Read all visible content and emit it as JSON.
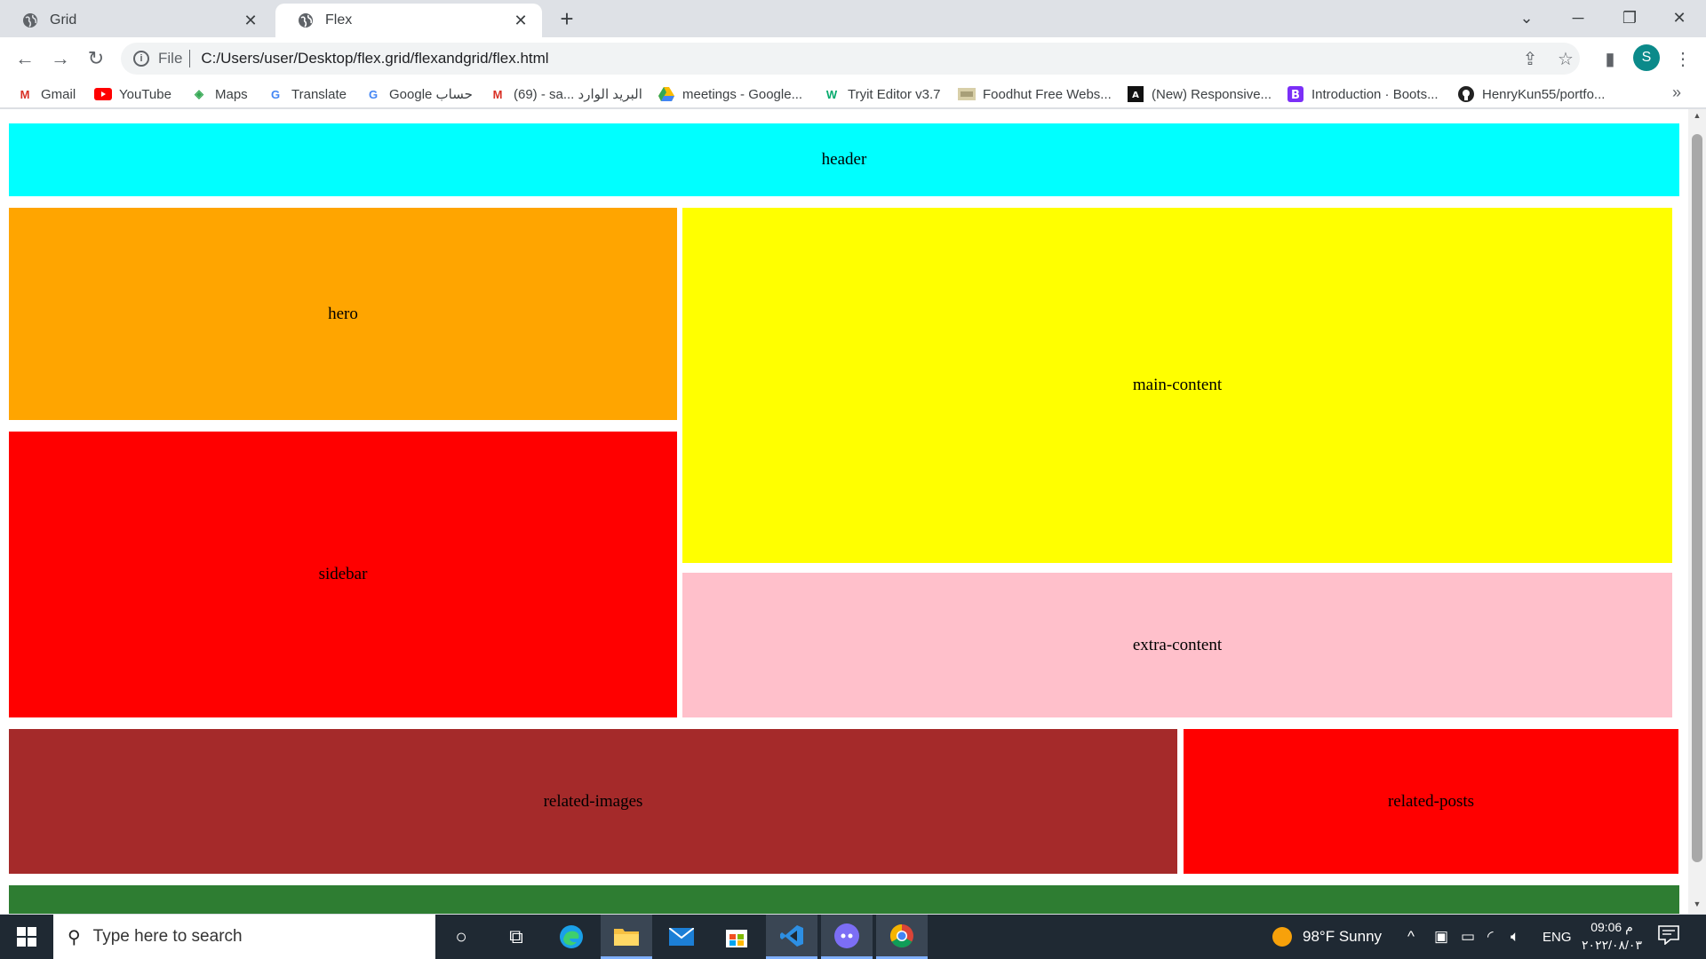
{
  "tabs": [
    {
      "title": "Grid",
      "active": false
    },
    {
      "title": "Flex",
      "active": true
    }
  ],
  "address": {
    "scheme": "File",
    "url": "C:/Users/user/Desktop/flex.grid/flexandgrid/flex.html"
  },
  "profile": {
    "initial": "S",
    "color": "#0b8a8a"
  },
  "bookmarks": [
    {
      "label": "Gmail",
      "icon": "gmail-icon"
    },
    {
      "label": "YouTube",
      "icon": "youtube-icon"
    },
    {
      "label": "Maps",
      "icon": "maps-icon"
    },
    {
      "label": "Translate",
      "icon": "translate-icon"
    },
    {
      "label": "Google حساب",
      "icon": "google-icon"
    },
    {
      "label": "(69) - sa... البريد الوارد",
      "icon": "gmail-icon"
    },
    {
      "label": "meetings - Google...",
      "icon": "drive-icon"
    },
    {
      "label": "Tryit Editor v3.7",
      "icon": "w3schools-icon"
    },
    {
      "label": "Foodhut Free Webs...",
      "icon": "foodhut-icon"
    },
    {
      "label": "(New) Responsive...",
      "icon": "responsive-icon"
    },
    {
      "label": "Introduction · Boots...",
      "icon": "bootstrap-icon"
    },
    {
      "label": "HenryKun55/portfo...",
      "icon": "github-icon"
    }
  ],
  "page": {
    "sections": [
      {
        "label": "header",
        "color": "#00ffff"
      },
      {
        "label": "hero",
        "color": "#ffa500"
      },
      {
        "label": "main-content",
        "color": "#ffff00"
      },
      {
        "label": "sidebar",
        "color": "#ff0000"
      },
      {
        "label": "extra-content",
        "color": "#ffc0cb"
      },
      {
        "label": "related-images",
        "color": "#a52a2a"
      },
      {
        "label": "related-posts",
        "color": "#ff0000"
      },
      {
        "label": "",
        "color": "#2e7d32"
      }
    ]
  },
  "taskbar": {
    "search_placeholder": "Type here to search",
    "weather": "98°F  Sunny",
    "language": "ENG",
    "time": "09:06 م",
    "date": "٢٠٢٢/٠٨/٠٣"
  }
}
